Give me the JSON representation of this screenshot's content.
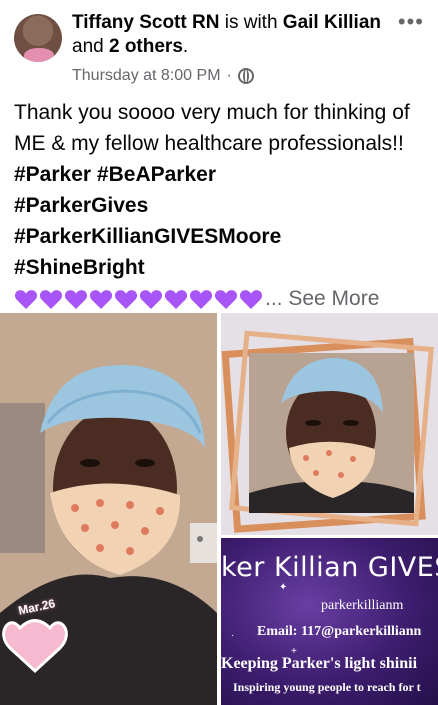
{
  "post": {
    "author": "Tiffany Scott RN",
    "with_text": " is with ",
    "tagged_person": "Gail Killian",
    "and_text": " and ",
    "others": "2 others",
    "period": ".",
    "timestamp": "Thursday at 8:00 PM",
    "separator": "·",
    "privacy_icon": "globe-icon",
    "more_icon": "•••",
    "body_text": "Thank you soooo very much for thinking of ME & my fellow healthcare professionals!! ",
    "hashtags": [
      "#Parker",
      "#BeAParker",
      "#ParkerGives",
      "#ParkerKillianGIVESMoore",
      "#ShineBright"
    ],
    "heart_count": 10,
    "heart_color": "#a855f7",
    "ellipsis": "...",
    "see_more": "See More"
  },
  "photos": {
    "left_sticker_date": "Mar.26",
    "flyer": {
      "title": "ker Killian GIVES",
      "handle": "parkerkillianm",
      "email": "Email: 117@parkerkilliann",
      "tagline": "Keeping Parker's light shinii",
      "subline": "Inspiring young people to reach for t"
    }
  },
  "colors": {
    "text_primary": "#050505",
    "text_secondary": "#65676b",
    "flyer_purple": "#3d1d6e",
    "scrub_cap": "#9cc6e0"
  }
}
